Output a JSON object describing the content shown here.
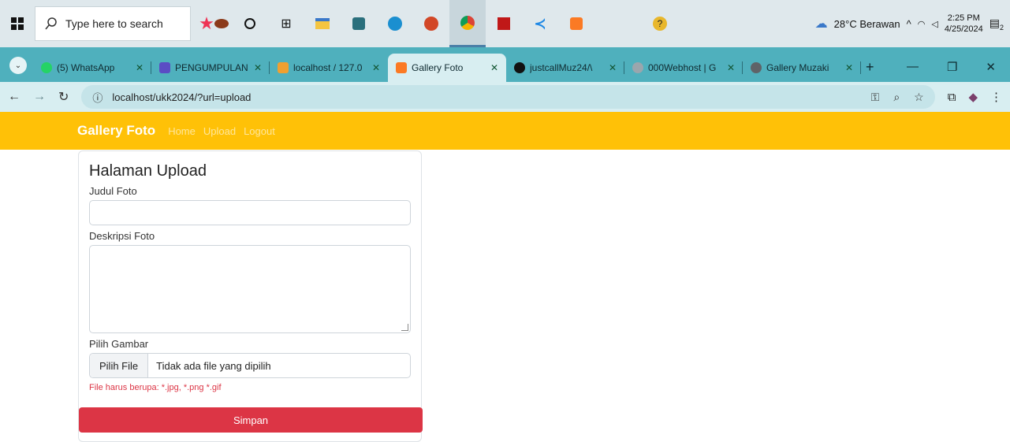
{
  "taskbar": {
    "search_placeholder": "Type here to search",
    "weather": "28°C  Berawan",
    "time": "2:25 PM",
    "date": "4/25/2024",
    "notification_count": "2"
  },
  "tabs": [
    {
      "label": "(5) WhatsApp",
      "icon": "whatsapp-icon",
      "color": "#25d366"
    },
    {
      "label": "PENGUMPULAN",
      "icon": "forms-icon",
      "color": "#5b4cc4"
    },
    {
      "label": "localhost / 127.0",
      "icon": "phpmyadmin-icon",
      "color": "#f0a030"
    },
    {
      "label": "Gallery Foto",
      "icon": "xampp-icon",
      "color": "#fb7a24"
    },
    {
      "label": "justcallMuz24/\\",
      "icon": "github-icon",
      "color": "#111111"
    },
    {
      "label": "000Webhost | G",
      "icon": "webhost-icon",
      "color": "#9aa6ad"
    },
    {
      "label": "Gallery Muzaki",
      "icon": "globe-icon",
      "color": "#5f6368"
    }
  ],
  "address": {
    "url": "localhost/ukk2024/?url=upload"
  },
  "navbar": {
    "brand": "Gallery Foto",
    "links": [
      "Home",
      "Upload",
      "Logout"
    ]
  },
  "form": {
    "heading": "Halaman Upload",
    "title_label": "Judul Foto",
    "title_value": "",
    "desc_label": "Deskripsi Foto",
    "desc_value": "",
    "file_label": "Pilih Gambar",
    "file_button": "Pilih File",
    "file_status": "Tidak ada file yang dipilih",
    "file_hint": "File harus berupa: *.jpg, *.png *.gif",
    "submit": "Simpan"
  },
  "colors": {
    "navbar": "#ffc107",
    "submit": "#dc3545",
    "tabstrip": "#4fb0bd"
  }
}
